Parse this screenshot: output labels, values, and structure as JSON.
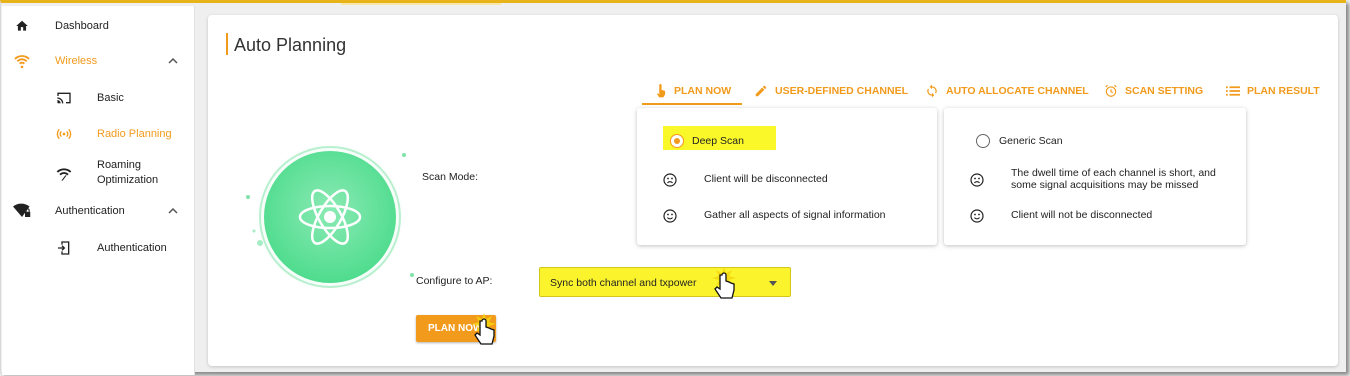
{
  "sidebar": {
    "items": [
      {
        "label": "Dashboard",
        "icon": "home-icon"
      },
      {
        "label": "Wireless",
        "icon": "wifi-icon"
      },
      {
        "label": "Basic",
        "icon": "cast-icon"
      },
      {
        "label": "Radio Planning",
        "icon": "radio-signal-icon"
      },
      {
        "label": "Roaming Optimization",
        "label_line1": "Roaming",
        "label_line2": "Optimization",
        "icon": "roaming-wifi-icon"
      },
      {
        "label": "Authentication",
        "icon": "auth-wifi-lock-icon"
      },
      {
        "label": "Authentication",
        "icon": "login-icon"
      }
    ]
  },
  "page": {
    "title": "Auto Planning"
  },
  "tabs": [
    {
      "label": "PLAN NOW",
      "icon": "touch-icon"
    },
    {
      "label": "USER-DEFINED CHANNEL",
      "icon": "pencil-icon"
    },
    {
      "label": "AUTO ALLOCATE CHANNEL",
      "icon": "refresh-icon"
    },
    {
      "label": "SCAN SETTING",
      "icon": "alarm-clock-icon"
    },
    {
      "label": "PLAN RESULT",
      "icon": "list-icon"
    }
  ],
  "form": {
    "scan_mode_label": "Scan Mode:",
    "configure_label": "Configure to AP:",
    "configure_value": "Sync both channel and txpower",
    "plan_button": "PLAN NOW"
  },
  "scan_options": [
    {
      "name": "Deep Scan",
      "selected": true,
      "point1": "Client will be disconnected",
      "point2": "Gather all aspects of signal information"
    },
    {
      "name": "Generic Scan",
      "selected": false,
      "point1a": "The dwell time of each channel is short, and",
      "point1b": "some signal acquisitions may be missed",
      "point2": "Client will not be disconnected"
    }
  ],
  "colors": {
    "accent": "#f29a1c",
    "highlight": "#fbf82a",
    "atom_green": "#5fe09a"
  }
}
